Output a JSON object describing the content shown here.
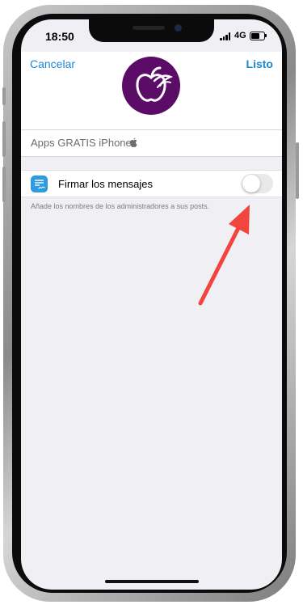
{
  "status_bar": {
    "time": "18:50",
    "network": "4G"
  },
  "header": {
    "cancel_label": "Cancelar",
    "done_label": "Listo",
    "avatar_color": "#5a0c67",
    "accent_color": "#1b87d3"
  },
  "channel": {
    "name": "Apps GRATIS iPhone",
    "name_icon": "apple-icon"
  },
  "settings": {
    "sign_messages": {
      "label": "Firmar los mensajes",
      "icon": "signature-icon",
      "icon_color": "#2e9be0",
      "enabled": false
    },
    "hint": "Añade los nombres de los administradores a sus posts."
  },
  "annotation": {
    "arrow_color": "#f2453d"
  }
}
